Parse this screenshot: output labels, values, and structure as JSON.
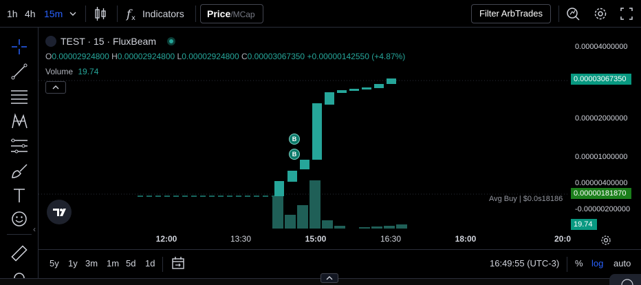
{
  "toolbar": {
    "intervals": [
      "1h",
      "4h",
      "15m"
    ],
    "active_interval": "15m",
    "indicators_label": "Indicators",
    "price_label": "Price",
    "price_sep": "/",
    "mcap_label": "MCap",
    "filter_label": "Filter ArbTrades"
  },
  "legend": {
    "symbol": "TEST · 15 · FluxBeam",
    "o_label": "O",
    "o_value": "0.00002924800",
    "h_label": "H",
    "h_value": "0.00002924800",
    "l_label": "L",
    "l_value": "0.00002924800",
    "c_label": "C",
    "c_value": "0.00003067350",
    "change": "+0.00000142550 (+4.87%)",
    "volume_label": "Volume",
    "volume_value": "19.74"
  },
  "price_axis": {
    "labels": [
      "0.00004000000",
      "0.00002000000",
      "0.00001000000",
      "0.00000400000",
      "-0.00000200000"
    ],
    "last_price_tag": "0.00003067350",
    "avg_buy_tag": "0.00000181870",
    "volume_tag": "19.74",
    "colors": {
      "up": "#26a69a",
      "volume": "#1f5f57",
      "last_tag": "#089981",
      "avg_tag": "#1b7f1b"
    }
  },
  "avg_buy_label": "Avg Buy | $0.0s18186",
  "time_axis": [
    "12:00",
    "13:30",
    "15:00",
    "16:30",
    "18:00",
    "20:0"
  ],
  "bottom": {
    "ranges": [
      "5y",
      "1y",
      "3m",
      "1m",
      "5d",
      "1d"
    ],
    "clock": "16:49:55 (UTC-3)",
    "percent": "%",
    "log": "log",
    "auto": "auto"
  },
  "markers": [
    "B",
    "B"
  ],
  "icons": [
    "candles-icon",
    "function-icon",
    "search-chart-icon",
    "settings-icon",
    "fullscreen-icon",
    "crosshair-icon",
    "trendline-icon",
    "fib-icon",
    "pattern-icon",
    "measure-lines-icon",
    "brush-icon",
    "text-icon",
    "emoji-icon",
    "ruler-icon",
    "calendar-goto-icon",
    "chevron-up-icon",
    "tradingview-logo-icon"
  ]
}
